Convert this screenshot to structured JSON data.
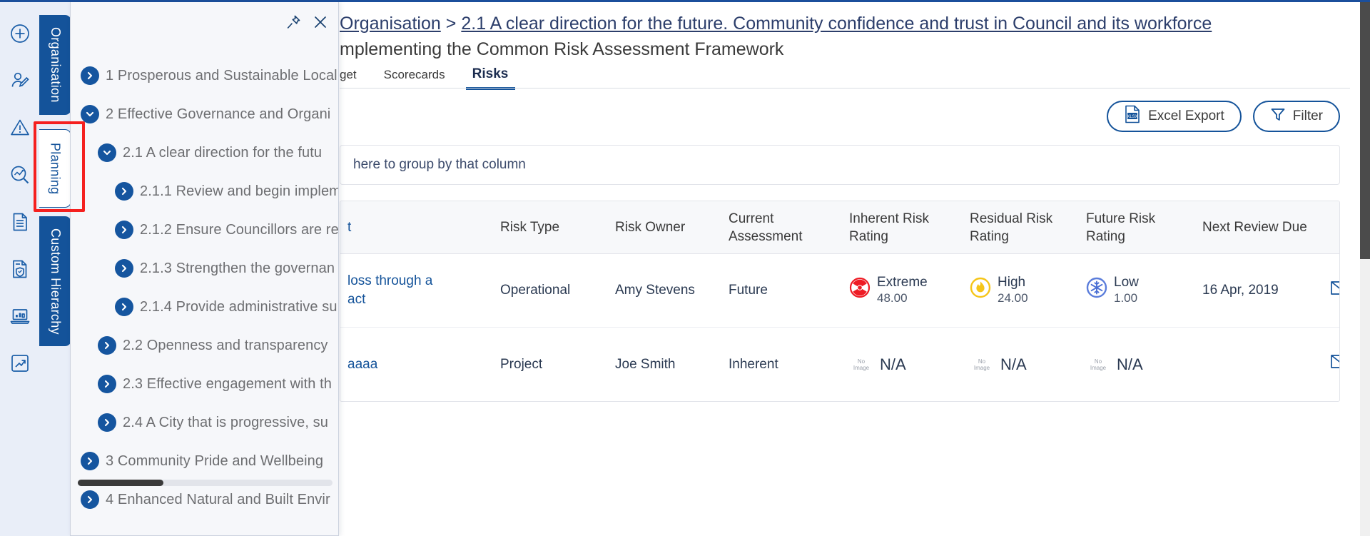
{
  "rail": {
    "icons": [
      {
        "name": "add-circle-icon",
        "label": "Add"
      },
      {
        "name": "user-edit-icon",
        "label": "Edit User"
      },
      {
        "name": "warning-triangle-icon",
        "label": "Risks"
      },
      {
        "name": "analytics-search-icon",
        "label": "Analyse"
      },
      {
        "name": "document-lines-icon",
        "label": "Documents"
      },
      {
        "name": "document-shield-icon",
        "label": "Compliance"
      },
      {
        "name": "laptop-chart-icon",
        "label": "Reports"
      },
      {
        "name": "trend-up-icon",
        "label": "Performance"
      }
    ]
  },
  "vertical_tabs": [
    {
      "id": "organisation",
      "label": "Organisation",
      "active": false
    },
    {
      "id": "planning",
      "label": "Planning",
      "active": true
    },
    {
      "id": "custom-hierarchy",
      "label": "Custom Hierarchy",
      "active": false
    }
  ],
  "tree_panel": {
    "pin_icon": "pin-icon",
    "close_icon": "close-icon",
    "items": [
      {
        "level": 0,
        "state": "collapsed",
        "label": "1 Prosperous and Sustainable Local"
      },
      {
        "level": 0,
        "state": "expanded",
        "label": "2 Effective Governance and Organi"
      },
      {
        "level": 1,
        "state": "expanded",
        "label": "2.1 A clear direction for the futu"
      },
      {
        "level": 2,
        "state": "collapsed",
        "label": "2.1.1 Review and begin implem"
      },
      {
        "level": 2,
        "state": "collapsed",
        "label": "2.1.2 Ensure Councillors are re"
      },
      {
        "level": 2,
        "state": "collapsed",
        "label": "2.1.3 Strengthen the governan"
      },
      {
        "level": 2,
        "state": "collapsed",
        "label": "2.1.4 Provide administrative su"
      },
      {
        "level": 1,
        "state": "collapsed",
        "label": "2.2 Openness and transparency"
      },
      {
        "level": 1,
        "state": "collapsed",
        "label": "2.3 Effective engagement with th"
      },
      {
        "level": 1,
        "state": "collapsed",
        "label": "2.4 A City that is progressive, su"
      },
      {
        "level": 0,
        "state": "collapsed",
        "label": "3 Community Pride and Wellbeing"
      },
      {
        "level": 0,
        "state": "collapsed",
        "label": "4 Enhanced Natural and Built Envir"
      }
    ]
  },
  "breadcrumb": {
    "root": "Organisation",
    "separator": ">",
    "current": "2.1 A clear direction for the future. Community confidence and trust in Council and its workforce",
    "subtitle": "mplementing the Common Risk Assessment Framework"
  },
  "tabs": [
    {
      "id": "target",
      "label": "get",
      "active": false
    },
    {
      "id": "scorecards",
      "label": "Scorecards",
      "active": false
    },
    {
      "id": "risks",
      "label": "Risks",
      "active": true
    }
  ],
  "toolbar": {
    "excel_export_label": "Excel Export",
    "excel_icon": "xlsx-file-icon",
    "filter_label": "Filter",
    "filter_icon": "funnel-icon"
  },
  "group_panel": {
    "hint": "here to group by that column"
  },
  "grid": {
    "columns": [
      {
        "key": "name",
        "label": "t"
      },
      {
        "key": "type",
        "label": "Risk Type"
      },
      {
        "key": "owner",
        "label": "Risk Owner"
      },
      {
        "key": "curr",
        "label": "Current Assessment"
      },
      {
        "key": "inh",
        "label": "Inherent Risk Rating"
      },
      {
        "key": "res",
        "label": "Residual Risk Rating"
      },
      {
        "key": "fut",
        "label": "Future Risk Rating"
      },
      {
        "key": "next",
        "label": "Next Review Due"
      },
      {
        "key": "mail",
        "label": ""
      }
    ],
    "rows": [
      {
        "name": "loss through a\nact",
        "type": "Operational",
        "owner": "Amy Stevens",
        "curr": "Future",
        "inherent": {
          "icon": "radiation-icon",
          "label": "Extreme",
          "value": "48.00",
          "color": "#ee1c25"
        },
        "residual": {
          "icon": "flame-icon",
          "label": "High",
          "value": "24.00",
          "color": "#f5c518"
        },
        "future": {
          "icon": "snowflake-icon",
          "label": "Low",
          "value": "1.00",
          "color": "#5b7ddb"
        },
        "next_review": "16 Apr, 2019",
        "mail_icon": "envelope-icon"
      },
      {
        "name": "aaaa",
        "type": "Project",
        "owner": "Joe Smith",
        "curr": "Inherent",
        "inherent": {
          "icon": "no-image-icon",
          "label": "N/A",
          "value": "",
          "color": "#9aa0ab"
        },
        "residual": {
          "icon": "no-image-icon",
          "label": "N/A",
          "value": "",
          "color": "#9aa0ab"
        },
        "future": {
          "icon": "no-image-icon",
          "label": "N/A",
          "value": "",
          "color": "#9aa0ab"
        },
        "next_review": "",
        "mail_icon": "envelope-icon"
      }
    ],
    "no_image_line1": "No",
    "no_image_line2": "Image"
  },
  "colors": {
    "brand_blue": "#14539a",
    "highlight_red": "#f5201f",
    "extreme": "#ee1c25",
    "high": "#f5c518",
    "low": "#5b7ddb"
  }
}
